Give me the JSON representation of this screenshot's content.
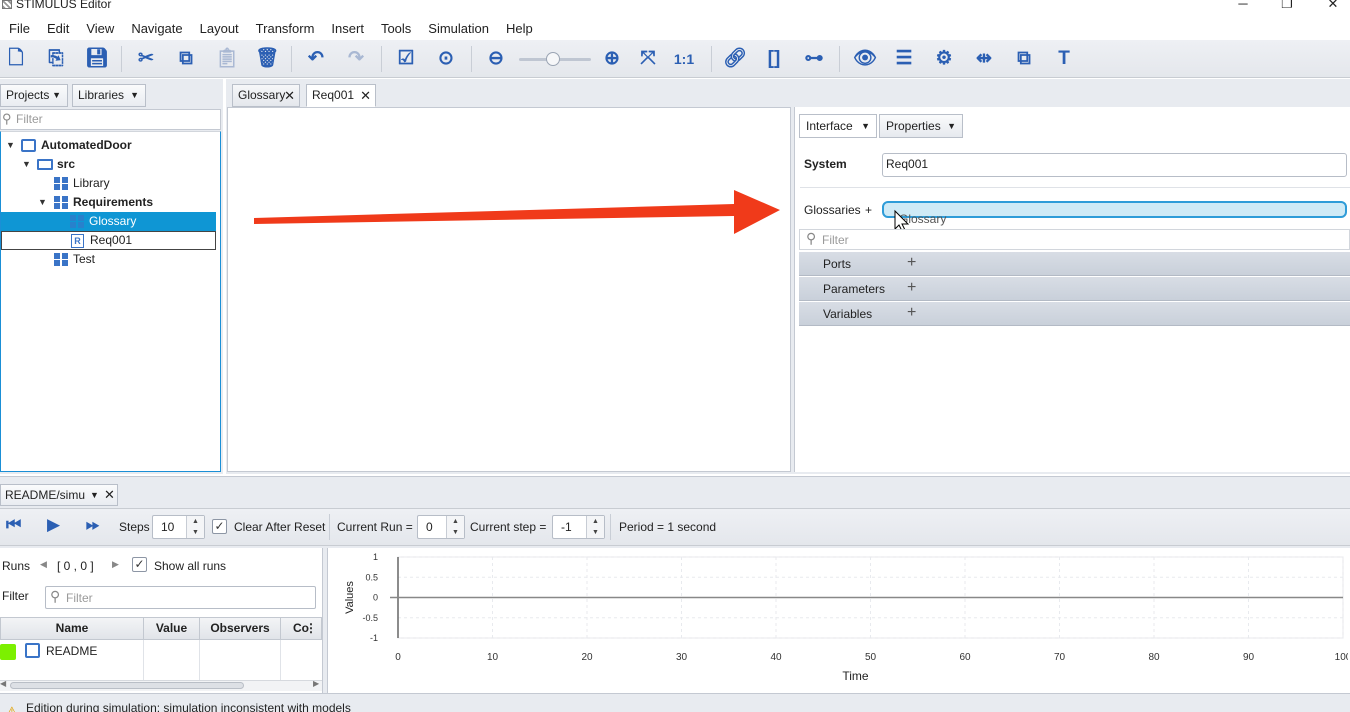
{
  "app": {
    "title": "STIMULUS Editor"
  },
  "menus": [
    "File",
    "Edit",
    "View",
    "Navigate",
    "Layout",
    "Transform",
    "Insert",
    "Tools",
    "Simulation",
    "Help"
  ],
  "toolbar": {
    "zoom_reset": "1:1"
  },
  "left_panel": {
    "tabs": [
      "Projects",
      "Libraries"
    ],
    "filter_placeholder": "Filter",
    "tree": {
      "project": "AutomatedDoor",
      "src": "src",
      "library": "Library",
      "requirements": "Requirements",
      "glossary": "Glossary",
      "req001": "Req001",
      "test": "Test"
    }
  },
  "editor": {
    "tabs": [
      "Glossary",
      "Req001"
    ]
  },
  "inspector": {
    "tabs": [
      "Interface",
      "Properties"
    ],
    "system_label": "System",
    "system_value": "Req001",
    "glossaries_label": "Glossaries",
    "glossaries_add": "+",
    "drag_text": "Glossary",
    "filter_placeholder": "Filter",
    "sections": [
      "Ports",
      "Parameters",
      "Variables"
    ]
  },
  "simulation": {
    "tab": "README/simu",
    "steps_label": "Steps",
    "steps_value": "10",
    "clear_after_reset": "Clear After Reset",
    "current_run_label": "Current Run =",
    "current_run_value": "0",
    "current_step_label": "Current step =",
    "current_step_value": "-1",
    "period": "Period = 1 second",
    "runs_label": "Runs",
    "runs_range": "[ 0 , 0 ]",
    "show_all_runs": "Show all runs",
    "filter_label": "Filter",
    "filter_placeholder": "Filter",
    "columns": [
      "Name",
      "Value",
      "Observers",
      "Co"
    ],
    "rows": [
      {
        "name": "README",
        "color": "#7cf000"
      }
    ]
  },
  "chart_data": {
    "type": "line",
    "xlabel": "Time",
    "ylabel": "Values",
    "xlim": [
      0,
      100
    ],
    "ylim": [
      -1,
      1
    ],
    "x_ticks": [
      "0",
      "10",
      "20",
      "30",
      "40",
      "50",
      "60",
      "70",
      "80",
      "90",
      "100"
    ],
    "y_ticks": [
      "1",
      "0.5",
      "0",
      "-0.5",
      "-1"
    ],
    "series": [
      {
        "values": []
      }
    ],
    "grid": true
  },
  "status": {
    "message": "Edition during simulation: simulation inconsistent with models"
  },
  "colors": {
    "accent": "#1e90d6",
    "arrow": "#f03a1a",
    "selection": "#1a8fd6"
  }
}
